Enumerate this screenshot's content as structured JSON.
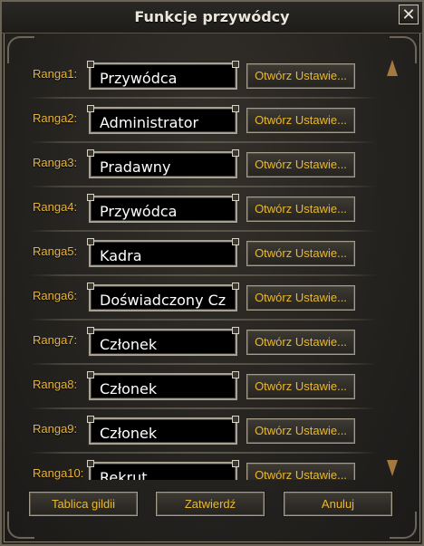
{
  "window": {
    "title": "Funkcje przywódcy",
    "close_label": "✕"
  },
  "ranks": [
    {
      "label": "Ranga1:",
      "name": "Przywódca",
      "button": "Otwórz Ustawie..."
    },
    {
      "label": "Ranga2:",
      "name": "Administrator",
      "button": "Otwórz Ustawie..."
    },
    {
      "label": "Ranga3:",
      "name": "Pradawny",
      "button": "Otwórz Ustawie..."
    },
    {
      "label": "Ranga4:",
      "name": "Przywódca",
      "button": "Otwórz Ustawie..."
    },
    {
      "label": "Ranga5:",
      "name": "Kadra",
      "button": "Otwórz Ustawie..."
    },
    {
      "label": "Ranga6:",
      "name": "Doświadczony Cz",
      "button": "Otwórz Ustawie..."
    },
    {
      "label": "Ranga7:",
      "name": "Członek",
      "button": "Otwórz Ustawie..."
    },
    {
      "label": "Ranga8:",
      "name": "Członek",
      "button": "Otwórz Ustawie..."
    },
    {
      "label": "Ranga9:",
      "name": "Członek",
      "button": "Otwórz Ustawie..."
    },
    {
      "label": "Ranga10:",
      "name": "Rekrut",
      "button": "Otwórz Ustawie..."
    }
  ],
  "footer": {
    "guild_board": "Tablica gildii",
    "apply": "Zatwierdź",
    "cancel": "Anuluj"
  }
}
